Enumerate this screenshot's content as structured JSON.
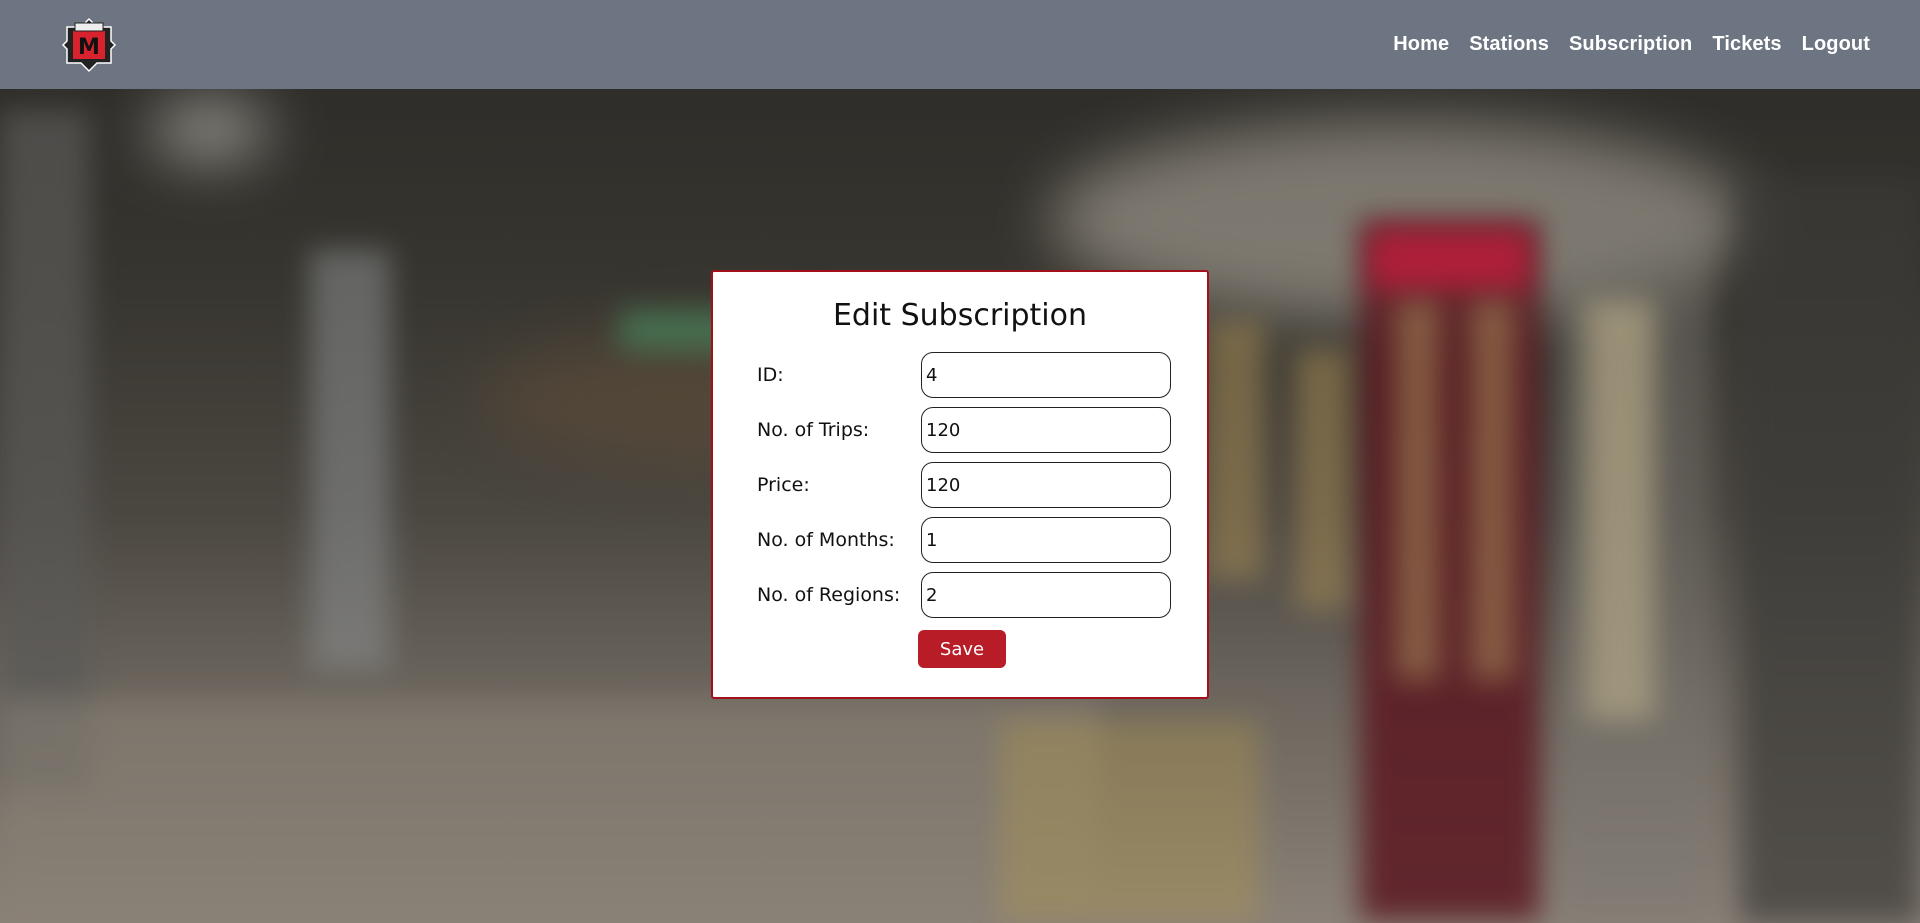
{
  "brand": {
    "logo_icon": "metro-logo-icon",
    "logo_letter": "M",
    "accent": "#b81c26"
  },
  "nav": {
    "items": [
      {
        "label": "Home"
      },
      {
        "label": "Stations"
      },
      {
        "label": "Subscription"
      },
      {
        "label": "Tickets"
      },
      {
        "label": "Logout"
      }
    ],
    "background": "#6c7581"
  },
  "form": {
    "title": "Edit Subscription",
    "fields": [
      {
        "label": "ID:",
        "value": "4"
      },
      {
        "label": "No. of Trips:",
        "value": "120"
      },
      {
        "label": "Price:",
        "value": "120"
      },
      {
        "label": "No. of Months:",
        "value": "1"
      },
      {
        "label": "No. of Regions:",
        "value": "2"
      }
    ],
    "save_label": "Save",
    "border_color": "#a3101b"
  }
}
